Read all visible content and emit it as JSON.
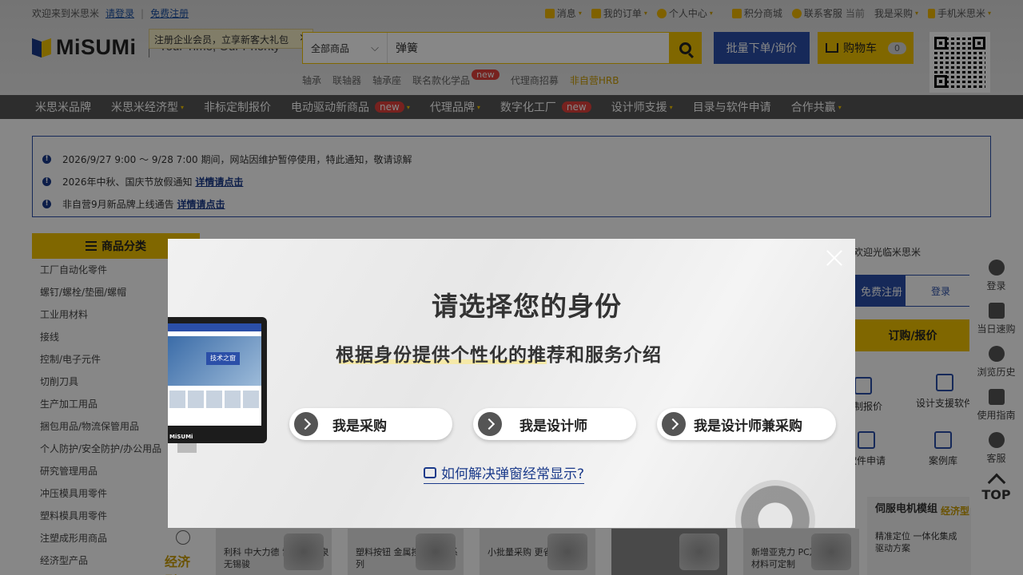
{
  "topbar": {
    "welcome": "欢迎来到米思米",
    "login": "请登录",
    "register": "免费注册",
    "links": [
      "消息",
      "我的订单",
      "个人中心",
      "积分商城",
      "联系客服",
      "当前",
      "我是采购",
      "手机米思米"
    ]
  },
  "brand": {
    "logo": "MiSUMi",
    "slogan": "Your Time, Our Priority"
  },
  "tooltip": {
    "text": "注册企业会员，立享新客大礼包",
    "close": "×"
  },
  "search": {
    "category": "全部商品",
    "value": "弹簧"
  },
  "hot_keywords": [
    "轴承",
    "联轴器",
    "轴承座",
    "联名款化学品",
    "代理商招募",
    "非自营HRB"
  ],
  "hot_new_badge": "new",
  "buttons": {
    "bulk": "批量下单/询价",
    "cart": "购物车",
    "cart_count": "0"
  },
  "nav": [
    {
      "label": "米思米品牌",
      "badge": "",
      "caret": ""
    },
    {
      "label": "米思米经济型",
      "badge": "",
      "caret": "▾"
    },
    {
      "label": "非标定制报价",
      "badge": "",
      "caret": ""
    },
    {
      "label": "电动驱动新商品",
      "badge": "new",
      "caret": "▾"
    },
    {
      "label": "代理品牌",
      "badge": "",
      "caret": "▾"
    },
    {
      "label": "数字化工厂",
      "badge": "new",
      "caret": ""
    },
    {
      "label": "设计师支援",
      "badge": "",
      "caret": "▾"
    },
    {
      "label": "目录与软件申请",
      "badge": "",
      "caret": ""
    },
    {
      "label": "合作共赢",
      "badge": "",
      "caret": "▾"
    }
  ],
  "notices": [
    {
      "text": "2026/9/27 9:00 ～ 9/28 7:00 期间，网站因维护暂停使用，特此通知，敬请谅解",
      "link": ""
    },
    {
      "text": "2026年中秋、国庆节放假通知",
      "link": "详情请点击"
    },
    {
      "text": "非自营9月新品牌上线通告",
      "link": "详情请点击"
    }
  ],
  "category": {
    "title": "商品分类",
    "items": [
      "工厂自动化零件",
      "螺钉/螺栓/垫圈/螺帽",
      "工业用材料",
      "接线",
      "控制/电子元件",
      "切削刀具",
      "生产加工用品",
      "捆包用品/物流保管用品",
      "个人防护/安全防护/办公用品",
      "研究管理用品",
      "冲压模具用零件",
      "塑料模具用零件",
      "注塑成形用商品",
      "经济型产品"
    ],
    "econ_badge": "经济型"
  },
  "welcome_panel": {
    "text": "欢迎光临米思米",
    "register": "免费注册",
    "login": "登录",
    "quote": "订购/报价",
    "tools": [
      "定制报价",
      "设计支援软件",
      "软件申请",
      "案例库"
    ]
  },
  "rail": {
    "items": [
      "登录",
      "当日速购",
      "浏览历史",
      "使用指南",
      "客服"
    ],
    "top": "TOP"
  },
  "tiles": [
    "利科 中大力德 雷诺德 和泉 无锡骏",
    "塑料按钮 金属按钮 开关系列",
    "小批量采购 更省心",
    "",
    "新增亚克力 PC及NAK80 材料可定制",
    "精准定位 一体化集成 驱动方案"
  ],
  "servo": {
    "title": "伺服电机模组",
    "eco": "经济型"
  },
  "modal": {
    "title": "请选择您的身份",
    "subtitle": "根据身份提供个性化的推荐和服务介绍",
    "options": [
      "我是采购",
      "我是设计师",
      "我是设计师兼采购"
    ],
    "faq": "如何解决弹窗经常显示?",
    "monitor_badge": "技术之窗",
    "monitor_brand": "MiSUMi"
  },
  "colors": {
    "accent": "#f2c300",
    "brand_blue": "#2b4fa8",
    "nav_bg": "#555555",
    "new_badge": "#e0413b"
  }
}
